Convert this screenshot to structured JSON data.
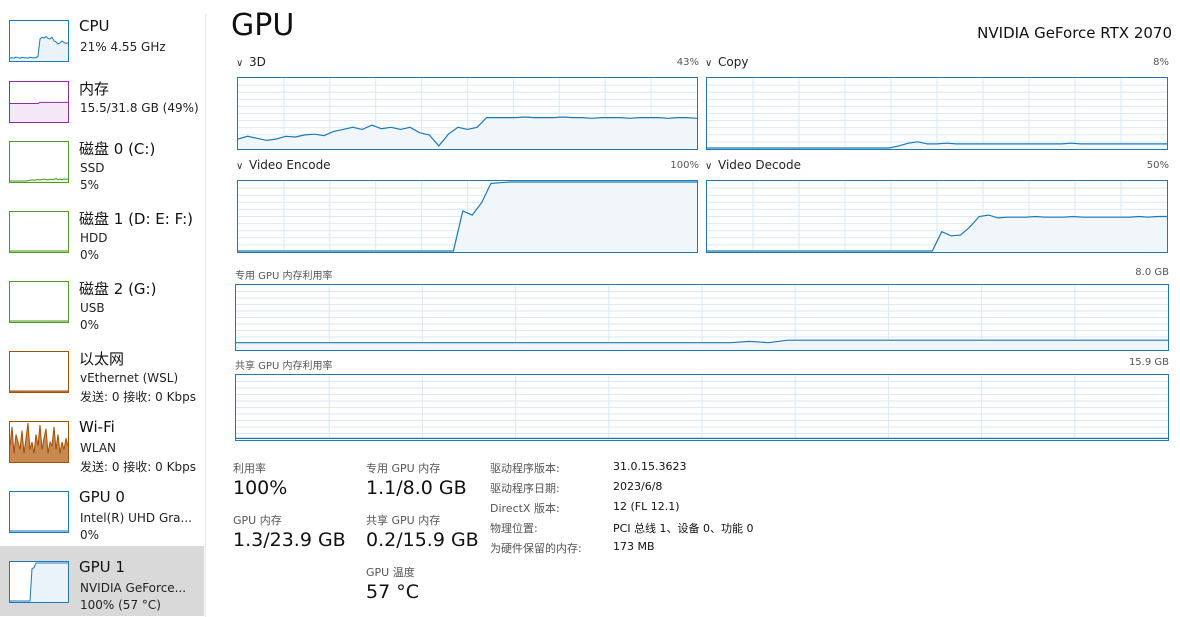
{
  "sidebar": {
    "items": [
      {
        "title": "CPU",
        "line2": "21% 4.55 GHz",
        "line3": "",
        "color": "#1c79b5",
        "history": [
          0.05,
          0.06,
          0.05,
          0.08,
          0.06,
          0.05,
          0.07,
          0.06,
          0.06,
          0.05,
          0.07,
          0.06,
          0.06,
          0.06,
          0.1,
          0.55,
          0.6,
          0.58,
          0.62,
          0.57,
          0.55,
          0.6,
          0.5,
          0.48,
          0.42,
          0.45,
          0.5,
          0.46,
          0.44,
          0.45
        ]
      },
      {
        "title": "内存",
        "line2": "15.5/31.8 GB (49%)",
        "line3": "",
        "color": "#8c2aa8",
        "history": [
          0.46,
          0.46,
          0.46,
          0.46,
          0.46,
          0.46,
          0.46,
          0.46,
          0.46,
          0.46,
          0.46,
          0.46,
          0.46,
          0.46,
          0.46,
          0.49,
          0.49,
          0.49,
          0.49,
          0.49,
          0.49,
          0.49,
          0.49,
          0.49,
          0.49,
          0.49,
          0.49,
          0.49,
          0.49,
          0.49
        ]
      },
      {
        "title": "磁盘 0 (C:)",
        "line2": "SSD",
        "line3": "5%",
        "color": "#4d9b1f",
        "history": [
          0,
          0,
          0,
          0,
          0,
          0,
          0,
          0,
          0,
          0.01,
          0.02,
          0.03,
          0.02,
          0.03,
          0.04,
          0.03,
          0.04,
          0.05,
          0.04,
          0.03,
          0.05,
          0.04,
          0.05,
          0.06,
          0.04,
          0.05,
          0.04,
          0.05,
          0.05,
          0.05
        ]
      },
      {
        "title": "磁盘 1 (D: E: F:)",
        "line2": "HDD",
        "line3": "0%",
        "color": "#4d9b1f",
        "history": [
          0,
          0,
          0,
          0,
          0,
          0,
          0,
          0,
          0,
          0,
          0,
          0,
          0,
          0,
          0,
          0,
          0,
          0,
          0,
          0,
          0,
          0,
          0,
          0,
          0,
          0,
          0,
          0,
          0,
          0
        ]
      },
      {
        "title": "磁盘 2 (G:)",
        "line2": "USB",
        "line3": "0%",
        "color": "#4d9b1f",
        "history": [
          0,
          0,
          0,
          0,
          0,
          0,
          0,
          0,
          0,
          0,
          0,
          0,
          0,
          0,
          0,
          0,
          0,
          0,
          0,
          0,
          0,
          0,
          0,
          0,
          0,
          0,
          0,
          0,
          0,
          0
        ]
      },
      {
        "title": "以太网",
        "line2": "vEthernet (WSL)",
        "line3": "发送: 0 接收: 0 Kbps",
        "color": "#a74f01",
        "history": [
          0,
          0,
          0,
          0,
          0,
          0,
          0,
          0,
          0,
          0,
          0,
          0,
          0,
          0,
          0,
          0,
          0,
          0,
          0,
          0,
          0,
          0,
          0,
          0,
          0,
          0,
          0,
          0,
          0,
          0
        ]
      },
      {
        "title": "Wi-Fi",
        "line2": "WLAN",
        "line3": "发送: 0 接收: 0 Kbps",
        "color": "#a74f01",
        "history": [
          0.4,
          0.9,
          0.2,
          0.7,
          0.5,
          0.3,
          0.8,
          0.2,
          0.6,
          1.0,
          0.3,
          0.5,
          0.2,
          0.7,
          0.4,
          0.95,
          0.3,
          0.6,
          0.85,
          0.2,
          0.5,
          0.4,
          0.9,
          0.3,
          0.7,
          0.2,
          0.5,
          0.3,
          0.6,
          0.4
        ]
      },
      {
        "title": "GPU 0",
        "line2": "Intel(R) UHD Gra...",
        "line3": "0%",
        "color": "#1c79b5",
        "history": [
          0,
          0,
          0,
          0,
          0,
          0,
          0,
          0,
          0,
          0,
          0,
          0,
          0,
          0,
          0,
          0,
          0,
          0,
          0,
          0,
          0,
          0,
          0,
          0,
          0,
          0,
          0,
          0,
          0,
          0
        ]
      },
      {
        "title": "GPU 1",
        "line2": "NVIDIA GeForce...",
        "line3": "100% (57 °C)",
        "color": "#1c79b5",
        "history": [
          0,
          0,
          0,
          0,
          0,
          0,
          0,
          0,
          0,
          0,
          0,
          0.85,
          0.88,
          1,
          1,
          1,
          1,
          1,
          1,
          1,
          1,
          1,
          1,
          1,
          1,
          1,
          1,
          1,
          1,
          1
        ]
      }
    ]
  },
  "header": {
    "title": "GPU",
    "device": "NVIDIA GeForce RTX 2070"
  },
  "graphs": {
    "g3d": {
      "label": "3D",
      "value": "43%",
      "history": [
        0.13,
        0.17,
        0.14,
        0.11,
        0.13,
        0.17,
        0.16,
        0.19,
        0.2,
        0.18,
        0.24,
        0.27,
        0.3,
        0.27,
        0.33,
        0.28,
        0.3,
        0.27,
        0.3,
        0.22,
        0.19,
        0.03,
        0.2,
        0.3,
        0.27,
        0.3,
        0.44,
        0.44,
        0.44,
        0.44,
        0.45,
        0.44,
        0.44,
        0.44,
        0.45,
        0.44,
        0.44,
        0.43,
        0.44,
        0.44,
        0.44,
        0.43,
        0.44,
        0.44,
        0.44,
        0.43,
        0.44,
        0.44,
        0.43
      ]
    },
    "copy": {
      "label": "Copy",
      "value": "8%",
      "history": [
        0,
        0,
        0,
        0,
        0,
        0,
        0,
        0,
        0,
        0,
        0,
        0,
        0,
        0,
        0,
        0,
        0,
        0,
        0,
        0,
        0.03,
        0.07,
        0.09,
        0.06,
        0.06,
        0.07,
        0.06,
        0.06,
        0.06,
        0.06,
        0.06,
        0.06,
        0.06,
        0.06,
        0.06,
        0.06,
        0.06,
        0.06,
        0.07,
        0.06,
        0.06,
        0.06,
        0.06,
        0.06,
        0.06,
        0.06,
        0.06,
        0.06,
        0.06
      ]
    },
    "encode": {
      "label": "Video Encode",
      "value": "100%",
      "history": [
        0,
        0,
        0,
        0,
        0,
        0,
        0,
        0,
        0,
        0,
        0,
        0,
        0,
        0,
        0,
        0,
        0,
        0,
        0,
        0,
        0,
        0,
        0,
        0,
        0.58,
        0.52,
        0.7,
        0.98,
        0.99,
        1,
        1,
        1,
        1,
        1,
        1,
        1,
        1,
        1,
        1,
        1,
        1,
        1,
        1,
        1,
        1,
        1,
        1,
        1,
        1,
        1
      ]
    },
    "decode": {
      "label": "Video Decode",
      "value": "50%",
      "history": [
        0,
        0,
        0,
        0,
        0,
        0,
        0,
        0,
        0,
        0,
        0,
        0,
        0,
        0,
        0,
        0,
        0,
        0,
        0,
        0,
        0,
        0,
        0,
        0,
        0,
        0.28,
        0.22,
        0.23,
        0.35,
        0.5,
        0.52,
        0.48,
        0.49,
        0.49,
        0.49,
        0.5,
        0.49,
        0.49,
        0.49,
        0.5,
        0.49,
        0.49,
        0.49,
        0.49,
        0.49,
        0.49,
        0.5,
        0.49,
        0.5,
        0.5
      ]
    },
    "dedicated": {
      "label": "专用 GPU 内存利用率",
      "value": "8.0 GB",
      "history": [
        0.1,
        0.1,
        0.1,
        0.1,
        0.1,
        0.1,
        0.1,
        0.1,
        0.1,
        0.1,
        0.1,
        0.1,
        0.1,
        0.1,
        0.1,
        0.1,
        0.1,
        0.1,
        0.1,
        0.1,
        0.1,
        0.1,
        0.1,
        0.1,
        0.1,
        0.1,
        0.1,
        0.12,
        0.1,
        0.14,
        0.14,
        0.14,
        0.14,
        0.14,
        0.14,
        0.14,
        0.14,
        0.14,
        0.14,
        0.14,
        0.14,
        0.14,
        0.14,
        0.14,
        0.14,
        0.14,
        0.14,
        0.14,
        0.14,
        0.14
      ]
    },
    "shared": {
      "label": "共享 GPU 内存利用率",
      "value": "15.9 GB",
      "history": [
        0.01,
        0.01,
        0.01,
        0.01,
        0.01,
        0.01,
        0.01,
        0.01,
        0.01,
        0.01,
        0.01,
        0.01,
        0.01,
        0.01,
        0.01,
        0.01,
        0.01,
        0.01,
        0.01,
        0.01,
        0.01,
        0.01,
        0.01,
        0.01,
        0.01,
        0.01,
        0.01,
        0.01,
        0.01,
        0.01,
        0.01,
        0.01,
        0.01,
        0.01,
        0.01,
        0.01,
        0.01,
        0.01,
        0.01,
        0.01,
        0.01,
        0.01,
        0.01,
        0.01,
        0.01,
        0.01,
        0.01,
        0.01,
        0.01,
        0.01
      ]
    }
  },
  "stats": {
    "utilization_label": "利用率",
    "utilization": "100%",
    "dedicated_label": "专用 GPU 内存",
    "dedicated": "1.1/8.0 GB",
    "gpu_mem_label": "GPU 内存",
    "gpu_mem": "1.3/23.9 GB",
    "shared_label": "共享 GPU 内存",
    "shared": "0.2/15.9 GB",
    "temp_label": "GPU 温度",
    "temp": "57 °C"
  },
  "info": [
    {
      "key": "驱动程序版本:",
      "value": "31.0.15.3623"
    },
    {
      "key": "驱动程序日期:",
      "value": "2023/6/8"
    },
    {
      "key": "DirectX 版本:",
      "value": "12 (FL 12.1)"
    },
    {
      "key": "物理位置:",
      "value": "PCI 总线 1、设备 0、功能 0"
    },
    {
      "key": "为硬件保留的内存:",
      "value": "173 MB"
    }
  ],
  "colors": {
    "gpu_line": "#1c79b5",
    "gpu_fill": "#f1f6fa",
    "grid": "#d9eaf5",
    "selected_bg": "#d9d9d9"
  }
}
